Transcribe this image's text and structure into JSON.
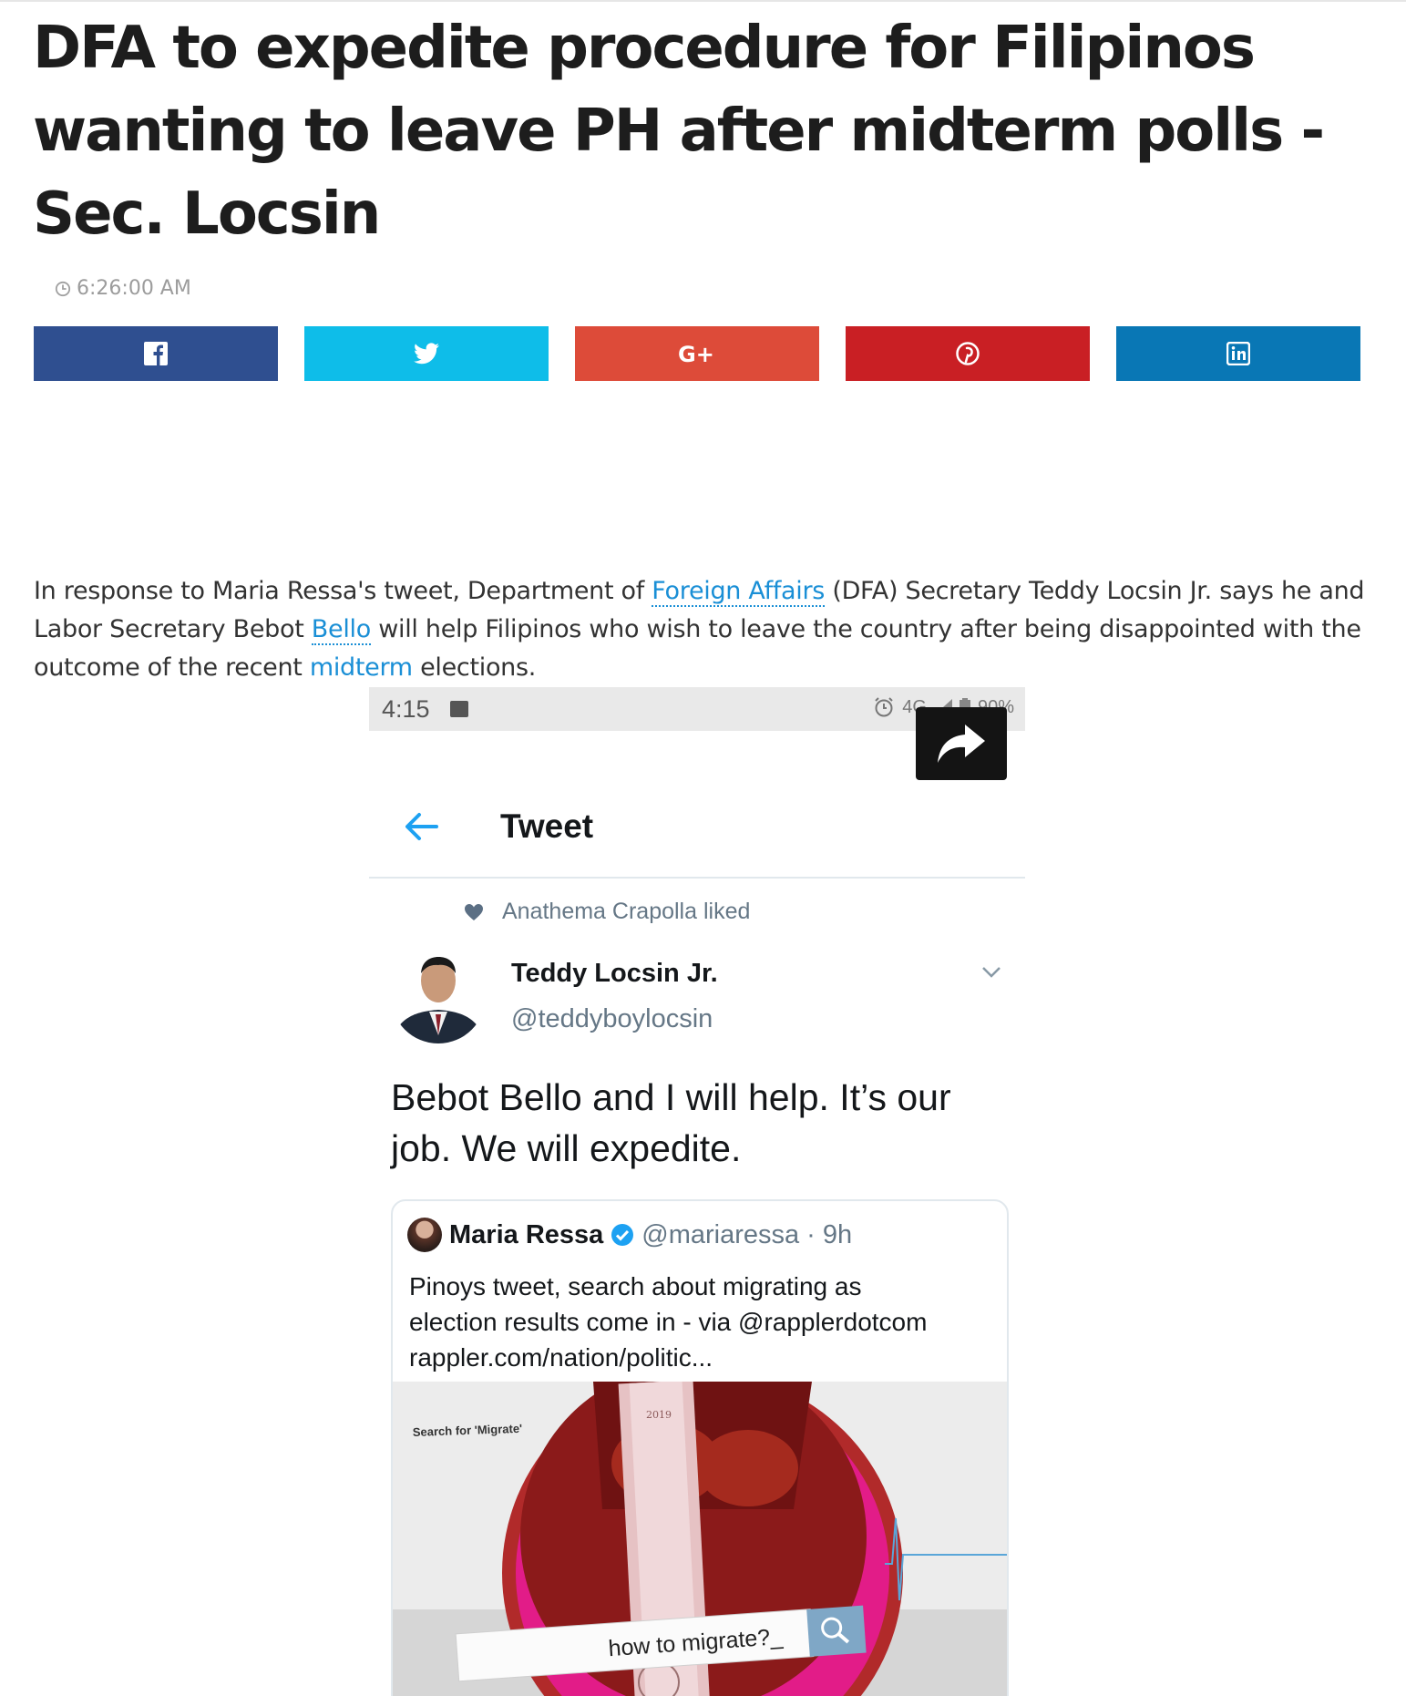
{
  "article": {
    "headline": "DFA to expedite procedure for Filipinos wanting to leave PH after midterm polls - Sec. Locsin",
    "time": "6:26:00 AM",
    "share_buttons": [
      {
        "network": "facebook",
        "icon": "facebook-icon",
        "color": "#2f4f90"
      },
      {
        "network": "twitter",
        "icon": "twitter-icon",
        "color": "#0ebde9"
      },
      {
        "network": "google-plus",
        "icon": "google-plus-icon",
        "color": "#dd4b39"
      },
      {
        "network": "pinterest",
        "icon": "pinterest-icon",
        "color": "#c91f24"
      },
      {
        "network": "linkedin",
        "icon": "linkedin-icon",
        "color": "#0977b5"
      }
    ],
    "lede": {
      "p1": "In response to Maria Ressa's tweet, Department of ",
      "link1": "Foreign Affairs",
      "p2": " (DFA) Secretary Teddy Locsin Jr. says he and Labor Secretary Bebot ",
      "link2": "Bello",
      "p3": " will help Filipinos who wish to leave the country after being disappointed with the outcome of the recent ",
      "link3": "midterm",
      "p4": " elections."
    }
  },
  "phone": {
    "status_time": "4:15",
    "status_network": "4G",
    "status_battery": "90%",
    "screen_title": "Tweet",
    "liked_by": "Anathema Crapolla liked",
    "author_name": "Teddy Locsin Jr.",
    "author_handle": "@teddyboylocsin",
    "tweet_text": "Bebot Bello and I will help. It’s our job. We will expedite.",
    "quote": {
      "name": "Maria Ressa",
      "handle": "@mariaressa",
      "age": "· 9h",
      "text_line1": "Pinoys tweet, search about migrating as",
      "text_line2": "election results come in - via @rapplerdotcom",
      "text_line3": "rappler.com/nation/politic...",
      "image_search_label": "Search for 'Migrate'",
      "image_search_query": "how to migrate?_",
      "image_year": "2019"
    }
  }
}
